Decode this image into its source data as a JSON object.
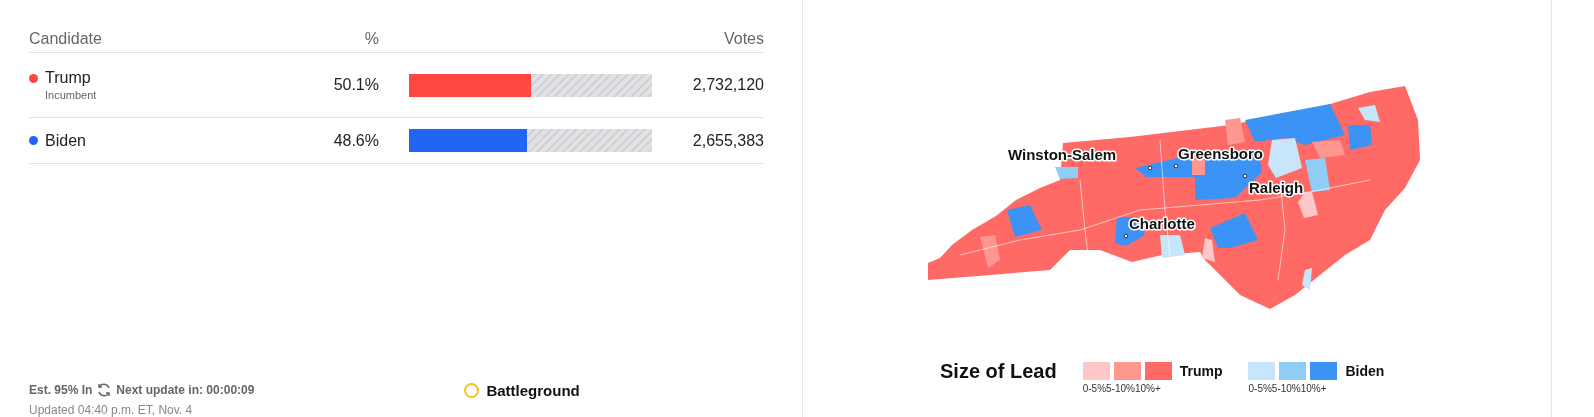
{
  "table": {
    "columns": [
      "Candidate",
      "%",
      "Votes"
    ],
    "rows": [
      {
        "name": "Trump",
        "note": "Incumbent",
        "color": "#ff4641",
        "percent": "50.1%",
        "level": 0.501,
        "votes": "2,732,120"
      },
      {
        "name": "Biden",
        "color": "#2166f3",
        "percent": "48.6%",
        "level": 0.486,
        "votes": "2,655,383"
      }
    ]
  },
  "footer": {
    "reporting": "Est. 95% In",
    "next_update": "Next update in: 00:00:09",
    "updated": "Updated 04:40 p.m. ET, Nov. 4"
  },
  "battleground": {
    "label": "Battleground"
  },
  "map": {
    "cities": [
      "Winston-Salem",
      "Greensboro",
      "Raleigh",
      "Charlotte"
    ]
  },
  "legend": {
    "title": "Size of Lead",
    "groups": [
      {
        "label": "Trump",
        "swatches": [
          {
            "label": "0-5%",
            "color": "#ffc8c8"
          },
          {
            "label": "5-10%",
            "color": "#ff9791"
          },
          {
            "label": "10%+",
            "color": "#ff6a66"
          }
        ]
      },
      {
        "label": "Biden",
        "swatches": [
          {
            "label": "0-5%",
            "color": "#c8e6fa"
          },
          {
            "label": "5-10%",
            "color": "#8fcdf6"
          },
          {
            "label": "10%+",
            "color": "#3b93f5"
          }
        ]
      }
    ]
  }
}
